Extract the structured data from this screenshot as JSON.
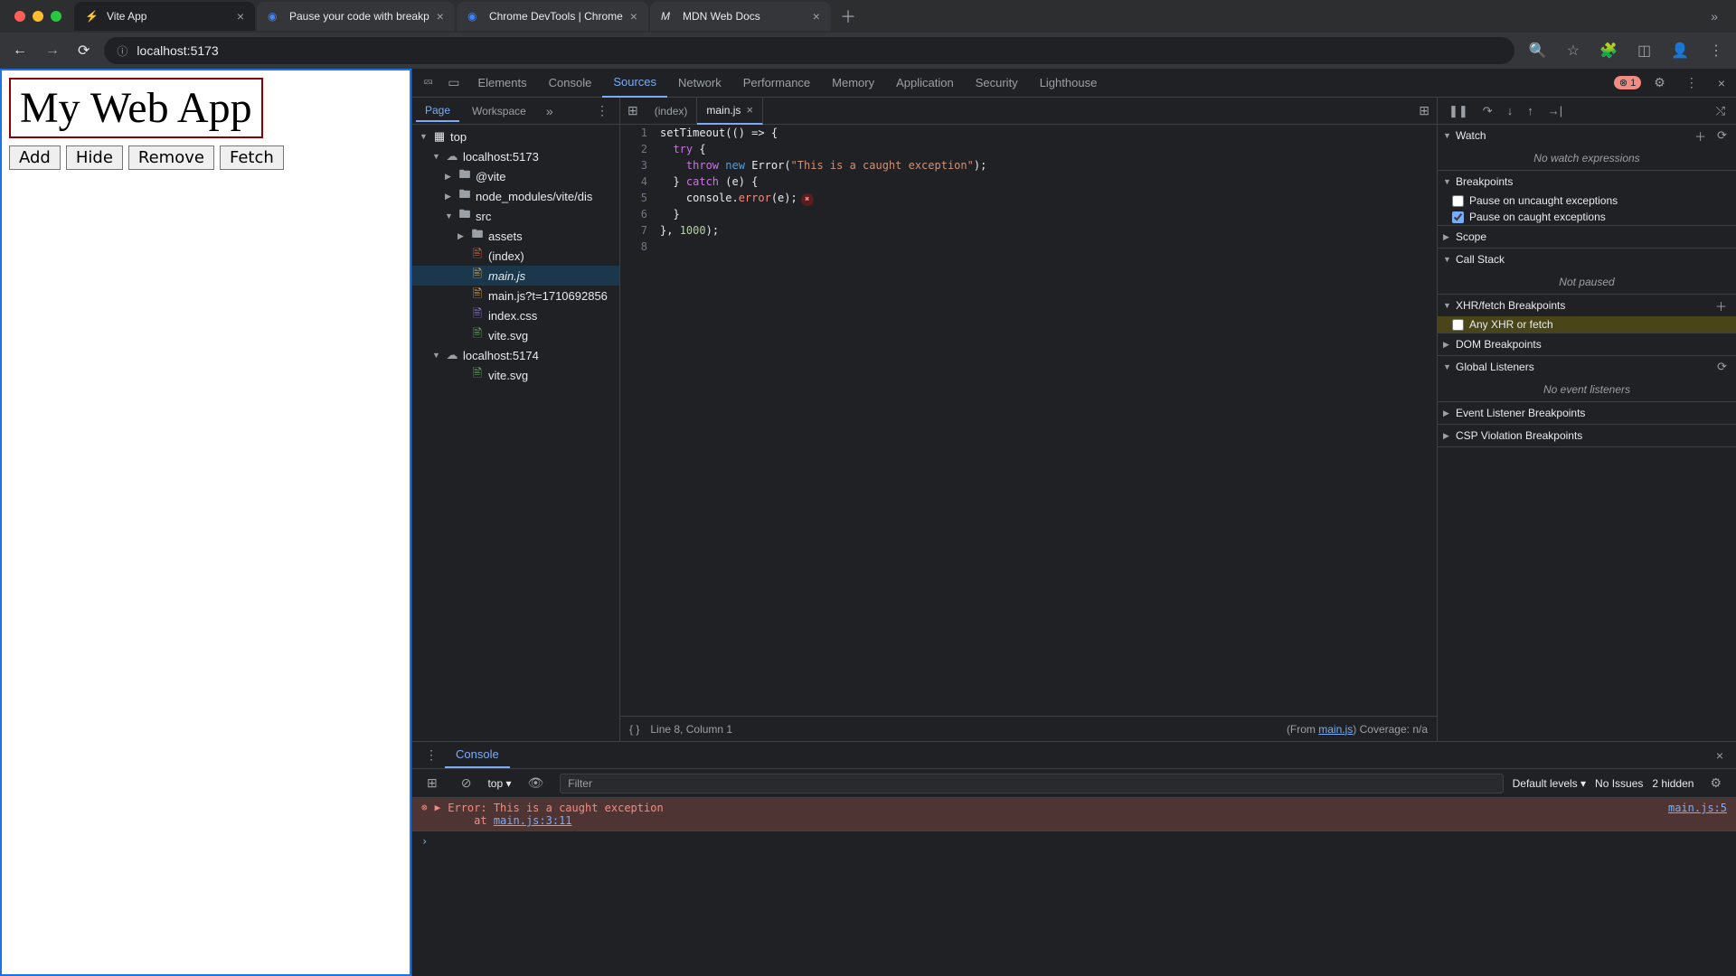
{
  "browser": {
    "tabs": [
      {
        "title": "Vite App",
        "favicon": "⚡"
      },
      {
        "title": "Pause your code with breakp",
        "favicon": "◉"
      },
      {
        "title": "Chrome DevTools  |  Chrome",
        "favicon": "◉"
      },
      {
        "title": "MDN Web Docs",
        "favicon": "M"
      }
    ],
    "url": "localhost:5173"
  },
  "page": {
    "title": "My Web App",
    "buttons": [
      "Add",
      "Hide",
      "Remove",
      "Fetch"
    ]
  },
  "devtools": {
    "tabs": [
      "Elements",
      "Console",
      "Sources",
      "Network",
      "Performance",
      "Memory",
      "Application",
      "Security",
      "Lighthouse"
    ],
    "active_tab": "Sources",
    "error_count": "1"
  },
  "sources": {
    "nav_tabs": [
      "Page",
      "Workspace"
    ],
    "tree": {
      "top": "top",
      "host1": "localhost:5173",
      "vite": "@vite",
      "node_modules": "node_modules/vite/dis",
      "src": "src",
      "assets": "assets",
      "index_html": "(index)",
      "main_js": "main.js",
      "main_js_q": "main.js?t=1710692856",
      "index_css": "index.css",
      "vite_svg": "vite.svg",
      "host2": "localhost:5174",
      "vite_svg2": "vite.svg"
    },
    "editor_tabs": [
      {
        "name": "(index)"
      },
      {
        "name": "main.js"
      }
    ],
    "code": {
      "l1a": "setTimeout",
      "l1b": "(() => {",
      "l2a": "try",
      "l2b": " {",
      "l3a": "throw",
      "l3b": "new",
      "l3c": "Error",
      "l3d": "(",
      "l3e": "\"This is a caught exception\"",
      "l3f": ");",
      "l4a": "} ",
      "l4b": "catch",
      "l4c": " (e) {",
      "l5a": "console.",
      "l5b": "error",
      "l5c": "(e);",
      "l6": "}",
      "l7a": "}, ",
      "l7b": "1000",
      "l7c": ");"
    },
    "status": {
      "cursor": "Line 8, Column 1",
      "from": "(From ",
      "from_link": "main.js",
      "from_suffix": ")",
      "coverage": "  Coverage: n/a"
    }
  },
  "debugger": {
    "watch": {
      "title": "Watch",
      "empty": "No watch expressions"
    },
    "breakpoints": {
      "title": "Breakpoints",
      "uncaught": "Pause on uncaught exceptions",
      "caught": "Pause on caught exceptions"
    },
    "scope": {
      "title": "Scope"
    },
    "callstack": {
      "title": "Call Stack",
      "empty": "Not paused"
    },
    "xhr": {
      "title": "XHR/fetch Breakpoints",
      "any": "Any XHR or fetch"
    },
    "dom": {
      "title": "DOM Breakpoints"
    },
    "global": {
      "title": "Global Listeners",
      "empty": "No event listeners"
    },
    "event": {
      "title": "Event Listener Breakpoints"
    },
    "csp": {
      "title": "CSP Violation Breakpoints"
    }
  },
  "console": {
    "tab": "Console",
    "context": "top",
    "filter_placeholder": "Filter",
    "levels": "Default levels",
    "issues": "No Issues",
    "hidden": "2 hidden",
    "error_text": "Error: This is a caught exception\n    at ",
    "error_link": "main.js:3:11",
    "error_src": "main.js:5"
  }
}
